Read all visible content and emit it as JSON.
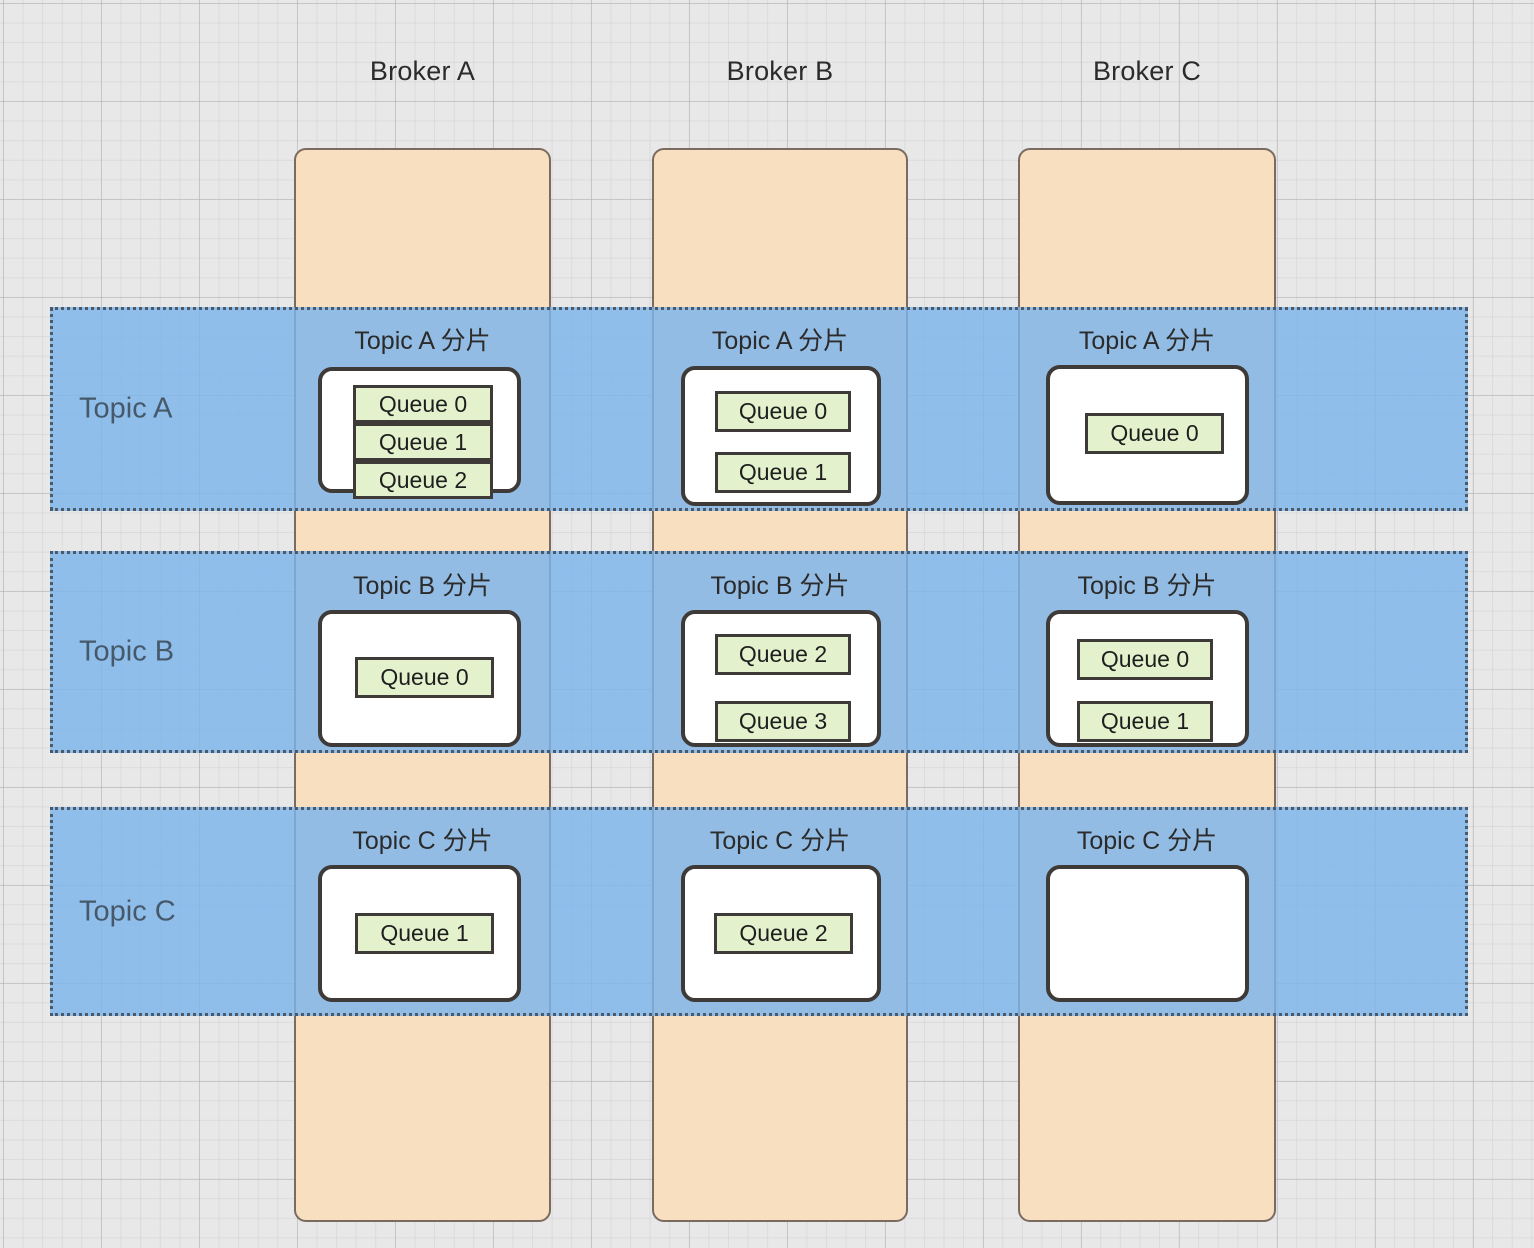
{
  "diagram": {
    "title": "Broker / Topic shard and queue distribution",
    "colors": {
      "canvas_background": "#e8e8e8",
      "broker_column_fill": "#f7dfc0",
      "broker_column_border": "#7a6a60",
      "topic_band_fill": "#7cb5ec",
      "topic_band_border": "#4a5a6a",
      "shard_box_fill": "#ffffff",
      "shard_box_border": "#3d3a38",
      "queue_fill": "#e3f1cd",
      "queue_border": "#3d3a38",
      "topic_label_text": "#46596b",
      "header_text": "#2b2b2b"
    }
  },
  "brokers": [
    {
      "id": "broker-a",
      "label": "Broker A"
    },
    {
      "id": "broker-b",
      "label": "Broker B"
    },
    {
      "id": "broker-c",
      "label": "Broker C"
    }
  ],
  "topics": [
    {
      "id": "topic-a",
      "label": "Topic A"
    },
    {
      "id": "topic-b",
      "label": "Topic B"
    },
    {
      "id": "topic-c",
      "label": "Topic C"
    }
  ],
  "shards": [
    {
      "id": "shard-a-a",
      "topic": "Topic A",
      "broker": "Broker A",
      "title": "Topic A 分片",
      "layout": "stacked-flush",
      "queues": [
        {
          "label": "Queue 0"
        },
        {
          "label": "Queue 1"
        },
        {
          "label": "Queue 2"
        }
      ]
    },
    {
      "id": "shard-a-b",
      "topic": "Topic A",
      "broker": "Broker B",
      "title": "Topic A 分片",
      "layout": "spaced",
      "queues": [
        {
          "label": "Queue 0"
        },
        {
          "label": "Queue 1"
        }
      ]
    },
    {
      "id": "shard-a-c",
      "topic": "Topic A",
      "broker": "Broker C",
      "title": "Topic A 分片",
      "layout": "single-center",
      "queues": [
        {
          "label": "Queue 0"
        }
      ]
    },
    {
      "id": "shard-b-a",
      "topic": "Topic B",
      "broker": "Broker A",
      "title": "Topic B 分片",
      "layout": "single-center",
      "queues": [
        {
          "label": "Queue 0"
        }
      ]
    },
    {
      "id": "shard-b-b",
      "topic": "Topic B",
      "broker": "Broker B",
      "title": "Topic B 分片",
      "layout": "spaced",
      "queues": [
        {
          "label": "Queue 2"
        },
        {
          "label": "Queue 3"
        }
      ]
    },
    {
      "id": "shard-b-c",
      "topic": "Topic B",
      "broker": "Broker C",
      "title": "Topic B 分片",
      "layout": "spaced",
      "queues": [
        {
          "label": "Queue 0"
        },
        {
          "label": "Queue 1"
        }
      ]
    },
    {
      "id": "shard-c-a",
      "topic": "Topic C",
      "broker": "Broker A",
      "title": "Topic C 分片",
      "layout": "single-center",
      "queues": [
        {
          "label": "Queue 1"
        }
      ]
    },
    {
      "id": "shard-c-b",
      "topic": "Topic C",
      "broker": "Broker B",
      "title": "Topic C 分片",
      "layout": "single-center",
      "queues": [
        {
          "label": "Queue 2"
        }
      ]
    },
    {
      "id": "shard-c-c",
      "topic": "Topic C",
      "broker": "Broker C",
      "title": "Topic C 分片",
      "layout": "empty",
      "queues": []
    }
  ]
}
